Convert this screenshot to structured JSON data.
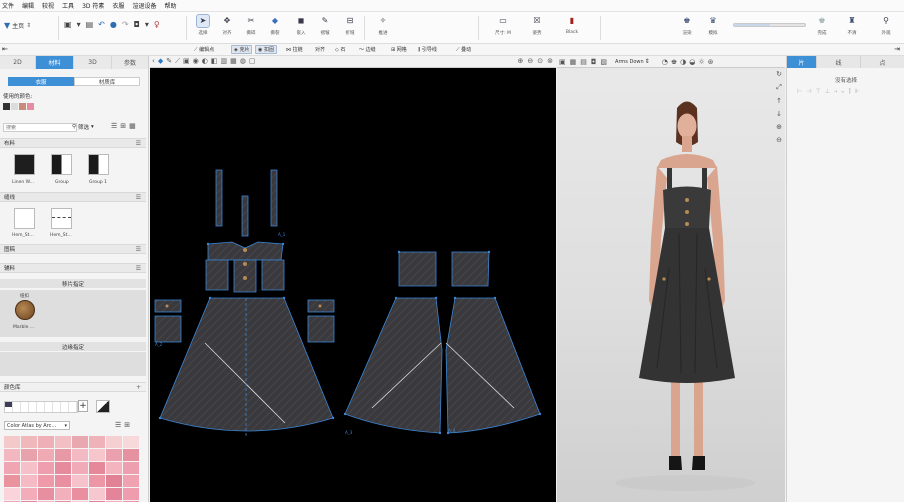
{
  "menu": [
    "文件",
    "编辑",
    "较视",
    "工具",
    "3D 符素",
    "衣服",
    "渲退设备",
    "帮助"
  ],
  "toolbar": {
    "home_label": "主页",
    "tools": [
      {
        "label": "选择",
        "icon": "select-arrow-icon"
      },
      {
        "label": "对齐",
        "icon": "align-icon"
      },
      {
        "label": "撕碎",
        "icon": "tear-icon"
      },
      {
        "label": "撕裂",
        "icon": "rip-icon"
      },
      {
        "label": "嵌入",
        "icon": "embed-icon"
      },
      {
        "label": "褶皱",
        "icon": "pleat-icon"
      },
      {
        "label": "折缝",
        "icon": "fold-icon"
      },
      {
        "label": "推进",
        "icon": "avatar-icon"
      }
    ],
    "avatar_settings": [
      {
        "label": "尺寸: M",
        "icon": "size-icon"
      },
      {
        "label": "姿势",
        "icon": "pose-icon"
      },
      {
        "label": "Black",
        "icon": "color-icon"
      }
    ],
    "render_tools": [
      {
        "label": "渲染",
        "icon": "shirt-render-icon"
      },
      {
        "label": "模拟",
        "icon": "shirt-sim-icon"
      }
    ],
    "right_tools": [
      {
        "label": "完成",
        "icon": "shirt-done-icon"
      },
      {
        "label": "不清",
        "icon": "shirt-clear-icon"
      },
      {
        "label": "外观",
        "icon": "pin-icon"
      }
    ],
    "slider_value": 0.5
  },
  "subtoolbar": {
    "items": [
      {
        "label": "编辑点",
        "selected": false
      },
      {
        "label": "克片",
        "selected": true
      },
      {
        "label": "扣固",
        "selected": true
      },
      {
        "label": "拉链",
        "selected": false
      },
      {
        "label": "对齐",
        "selected": false
      },
      {
        "label": "石",
        "selected": false
      },
      {
        "label": "边缝",
        "selected": false
      },
      {
        "label": "网格",
        "selected": false
      },
      {
        "label": "引导线",
        "selected": false
      },
      {
        "label": "叠动",
        "selected": false
      }
    ]
  },
  "left_panel": {
    "tabs": [
      "2D",
      "材料",
      "3D",
      "参数"
    ],
    "active_tab": 1,
    "subtabs": [
      "衣服",
      "材质库"
    ],
    "used_colors_label": "使用的颜色:",
    "used_colors": [
      "#333333",
      "#dcdcdc",
      "#c88c7c",
      "#e58ca2"
    ],
    "search_placeholder": "搜索",
    "filter_label": "筛选",
    "sections": {
      "fabric": "布料",
      "seam": "缝线",
      "pattern": "图稿",
      "trim": "辅料",
      "pieces_fixed": "移片指定",
      "edges_fixed": "边缘指定",
      "color_lib": "颜色库"
    },
    "fabrics": [
      {
        "name": "Linen W...",
        "color": "#2b2b2b"
      },
      {
        "name": "Group",
        "color": "#1f1f1f"
      },
      {
        "name": "Group 1",
        "color": "#1f1f1f"
      }
    ],
    "seams": [
      {
        "name": "Hem_St..."
      },
      {
        "name": "Hem_St..."
      }
    ],
    "trims": [
      {
        "name": "Marble ...",
        "top": "纽扣"
      }
    ],
    "color_atlas": "Color Atlas by Arc...",
    "palette": [
      "#f4c9c9",
      "#f1b8bc",
      "#eeb0b6",
      "#f2c0c4",
      "#e9a8b0",
      "#f0b2b9",
      "#f5cfd2",
      "#f8d9db",
      "#f2b7bf",
      "#e8a2ab",
      "#f0aab3",
      "#e79aa5",
      "#f3bac3",
      "#f7c5cc",
      "#eaa0ad",
      "#e6919f",
      "#efa5b2",
      "#f6c0c8",
      "#ee9eae",
      "#e58b9c",
      "#f1aab7",
      "#e4889a",
      "#f3b4c0",
      "#ed9eaf",
      "#e9939f",
      "#f5bac4",
      "#ef99a9",
      "#e98fa1",
      "#f6c3cc",
      "#ec96a6",
      "#e18196",
      "#f0a2b1",
      "#fbd3da",
      "#f2acba",
      "#e88ea1",
      "#f2b0bd",
      "#ea8f9f",
      "#f7c7d0",
      "#e4849a",
      "#ee9cae",
      "#f0a5b4",
      "#e58a9e",
      "#f4b8c4",
      "#ea90a3",
      "#f8ccd4",
      "#e3829a",
      "#f3afbd",
      "#ec95a8"
    ]
  },
  "canvas2d": {
    "labels": [
      "A_1",
      "A_2",
      "A_3",
      "A_4"
    ]
  },
  "canvas3d": {
    "pose_label": "Arms Down"
  },
  "right_panel": {
    "tabs": [
      "片",
      "线",
      "点"
    ],
    "active_tab": 0,
    "empty_label": "没有选择"
  }
}
